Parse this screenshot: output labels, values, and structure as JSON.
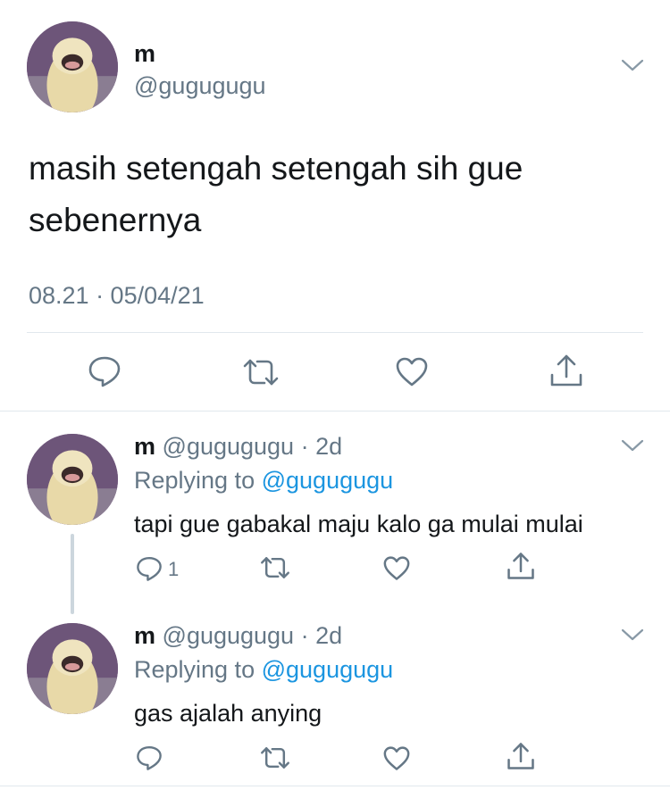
{
  "main_tweet": {
    "display_name": "m",
    "handle": "@gugugugu",
    "text": "masih setengah setengah sih gue sebenernya",
    "timestamp": "08.21 · 05/04/21",
    "actions": [
      "reply-icon",
      "retweet-icon",
      "like-icon",
      "share-icon"
    ]
  },
  "replies": [
    {
      "display_name": "m",
      "handle": "@gugugugu",
      "age": "· 2d",
      "replying_prefix": "Replying to",
      "replying_handle": "@gugugugu",
      "text": "tapi gue gabakal maju kalo ga mulai mulai",
      "reply_count": "1"
    },
    {
      "display_name": "m",
      "handle": "@gugugugu",
      "age": "· 2d",
      "replying_prefix": "Replying to",
      "replying_handle": "@gugugugu",
      "text": "gas ajalah anying",
      "reply_count": ""
    }
  ],
  "colors": {
    "text": "#14171a",
    "secondary": "#657786",
    "link": "#1b95e0",
    "divider": "#e1e8ed"
  }
}
